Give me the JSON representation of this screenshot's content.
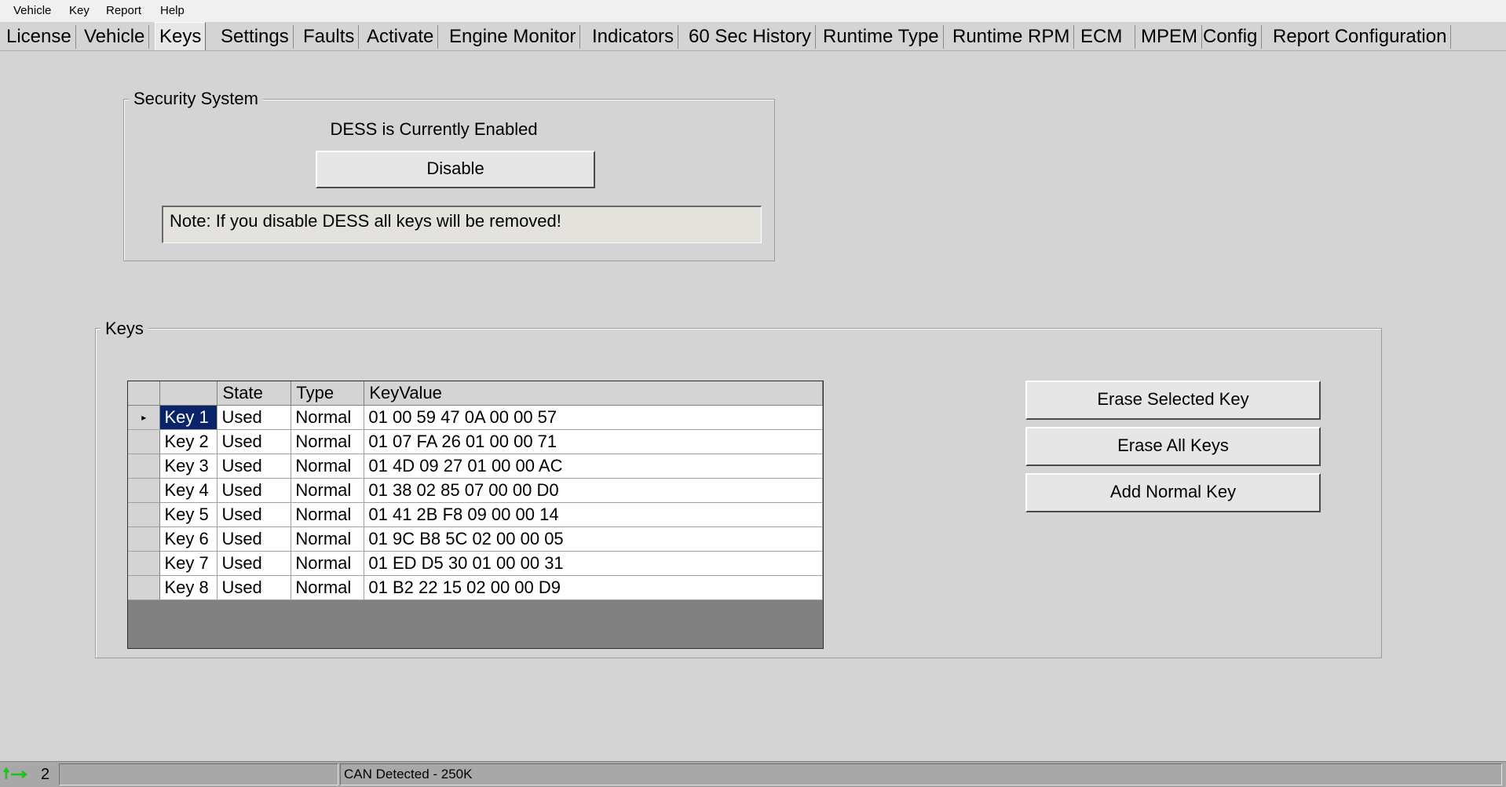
{
  "menu": [
    "Vehicle",
    "Key",
    "Report",
    "Help"
  ],
  "tabs": [
    "License",
    "Vehicle",
    "Keys",
    "Settings",
    "Faults",
    "Activate",
    "Engine Monitor",
    "Indicators",
    "60 Sec History",
    "Runtime Type",
    "Runtime RPM",
    "ECM",
    "MPEM",
    "Config",
    "Report Configuration"
  ],
  "active_tab": "Keys",
  "security": {
    "title": "Security System",
    "status": "DESS is Currently Enabled",
    "disable_label": "Disable",
    "note": "Note: If you disable DESS all keys will be removed!"
  },
  "keys": {
    "title": "Keys",
    "columns": [
      "",
      "State",
      "Type",
      "KeyValue"
    ],
    "rows": [
      {
        "name": "Key 1",
        "state": "Used",
        "type": "Normal",
        "value": "01 00 59 47 0A 00 00 57"
      },
      {
        "name": "Key 2",
        "state": "Used",
        "type": "Normal",
        "value": "01 07 FA 26 01 00 00 71"
      },
      {
        "name": "Key 3",
        "state": "Used",
        "type": "Normal",
        "value": "01 4D 09 27 01 00 00 AC"
      },
      {
        "name": "Key 4",
        "state": "Used",
        "type": "Normal",
        "value": "01 38 02 85 07 00 00 D0"
      },
      {
        "name": "Key 5",
        "state": "Used",
        "type": "Normal",
        "value": "01 41 2B F8 09 00 00 14"
      },
      {
        "name": "Key 6",
        "state": "Used",
        "type": "Normal",
        "value": "01 9C B8 5C 02 00 00 05"
      },
      {
        "name": "Key 7",
        "state": "Used",
        "type": "Normal",
        "value": "01 ED D5 30 01 00 00 31"
      },
      {
        "name": "Key 8",
        "state": "Used",
        "type": "Normal",
        "value": "01 B2 22 15 02 00 00 D9"
      }
    ],
    "erase_selected_label": "Erase Selected  Key",
    "erase_all_label": "Erase All Keys",
    "add_normal_label": "Add Normal Key"
  },
  "status": {
    "count": "2",
    "message": "CAN Detected - 250K"
  }
}
